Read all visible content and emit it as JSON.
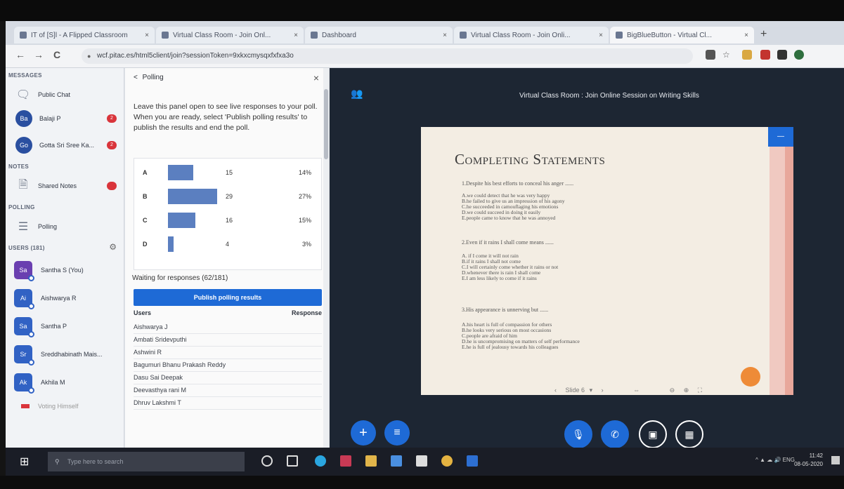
{
  "browser": {
    "tabs": [
      {
        "title": "IT of [S]l - A Flipped Classroom"
      },
      {
        "title": "Virtual Class Room - Join Onl..."
      },
      {
        "title": "Dashboard"
      },
      {
        "title": "Virtual Class Room - Join Onli..."
      },
      {
        "title": "BigBlueButton - Virtual Cl..."
      }
    ],
    "url": "wcf.pitac.es/html5client/join?sessionToken=9xkxcmysqxfxfxa3o",
    "back_icon": "←",
    "forward_icon": "→",
    "reload_icon": "C",
    "new_tab_label": "+"
  },
  "sidebar": {
    "messages_title": "MESSAGES",
    "public_chat": "Public Chat",
    "chats": [
      {
        "initials": "Ba",
        "name": "Balaji P",
        "badge": "2"
      },
      {
        "initials": "Go",
        "name": "Gotta Sri Sree Ka...",
        "badge": "2"
      }
    ],
    "notes_title": "NOTES",
    "shared_notes": "Shared Notes",
    "shared_notes_badge": "",
    "polling_title": "POLLING",
    "polling_item": "Polling",
    "users_title": "USERS (181)",
    "users": [
      {
        "initials": "Sa",
        "name": "Santha S (You)"
      },
      {
        "initials": "Ai",
        "name": "Aishwarya R"
      },
      {
        "initials": "Sa",
        "name": "Santha P"
      },
      {
        "initials": "Sr",
        "name": "Sreddhabinath Mais..."
      },
      {
        "initials": "Ak",
        "name": "Akhila M"
      }
    ],
    "bottom_item": "Voting Himself"
  },
  "poll": {
    "header": "Polling",
    "back_icon": "<",
    "close_icon": "×",
    "description": "Leave this panel open to see live responses to your poll. When you are ready, select 'Publish polling results' to publish the results and end the poll.",
    "results": [
      {
        "option": "A",
        "count": "15",
        "percent": "14%",
        "fraction": 0.14
      },
      {
        "option": "B",
        "count": "29",
        "percent": "27%",
        "fraction": 0.27
      },
      {
        "option": "C",
        "count": "16",
        "percent": "15%",
        "fraction": 0.15
      },
      {
        "option": "D",
        "count": "4",
        "percent": "3%",
        "fraction": 0.03
      }
    ],
    "waiting": "Waiting for responses (62/181)",
    "publish_button": "Publish polling results",
    "users_header": "Users",
    "response_header": "Response",
    "users": [
      "Aishwarya J",
      "Ambati Sridevputhi",
      "Ashwini R",
      "Bagumuri Bhanu Prakash Reddy",
      "Dasu Sai Deepak",
      "Deevasthya rani M",
      "Dhruv Lakshmi T"
    ]
  },
  "presentation": {
    "title": "Virtual Class Room : Join Online Session on Writing Skills",
    "slide": {
      "title": "Completing Statements",
      "questions": [
        {
          "q": "1.Despite his best efforts to conceal his anger ......",
          "options": [
            "A.we could detect that he was very happy",
            "B.he failed to give us an impression of his agony",
            "C.he succeeded in camouflaging his emotions",
            "D.we could succeed in doing it easily",
            "E.people came to know that he was annoyed"
          ]
        },
        {
          "q": "2.Even if it rains I shall come means ......",
          "options": [
            "A. if I come it will not rain",
            "B.if it rains I shall not come",
            "C.I will certainly come whether it rains or not",
            "D.whenever there is rain I shall come",
            "E.I am less likely to come if it rains"
          ]
        },
        {
          "q": "3.His appearance is unnerving but ......",
          "options": [
            "A.his heart is full of compassion for others",
            "B.he looks very serious on most occasions",
            "C.people are afraid of him",
            "D.he is uncompromising on matters of self performance",
            "E.he is full of jealousy towards his colleagues"
          ]
        }
      ],
      "slide_label": "Slide 6",
      "prev_icon": "‹",
      "next_icon": "›"
    },
    "fab_plus": "+",
    "fab_list": "≡"
  },
  "taskbar": {
    "search_placeholder": "Type here to search",
    "time": "11:42",
    "date": "08-05-2020",
    "lang": "ENG"
  }
}
